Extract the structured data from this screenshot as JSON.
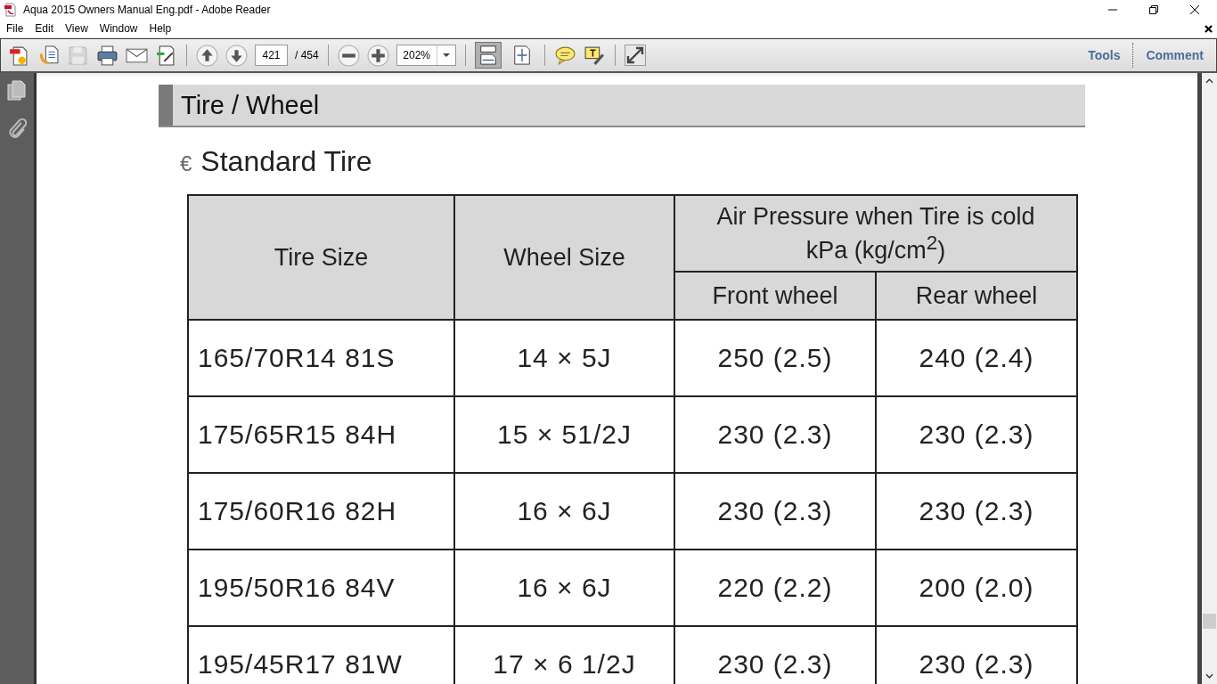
{
  "window": {
    "title": "Aqua 2015 Owners Manual Eng.pdf - Adobe Reader"
  },
  "menu": [
    "File",
    "Edit",
    "View",
    "Window",
    "Help"
  ],
  "toolbar": {
    "save_disabled": true,
    "page_number": "421",
    "page_total": "/ 454",
    "zoom": "202%",
    "view_modes": [
      {
        "selected": true
      },
      {
        "selected": false
      }
    ],
    "panels": [
      "Tools",
      "Comment"
    ]
  },
  "document": {
    "heading": "Tire / Wheel",
    "subheading_bullet": "€",
    "subheading": "Standard Tire",
    "table": {
      "columns": [
        "Tire Size",
        "Wheel Size"
      ],
      "group_header": [
        "Air Pressure when Tire is cold",
        "kPa (kg/cm$^{2}$)"
      ],
      "subcolumns": [
        "Front wheel",
        "Rear wheel"
      ],
      "rows": [
        [
          "165/70R14 81S",
          "14 × 5J",
          "250 (2.5)",
          "240 (2.4)"
        ],
        [
          "175/65R15 84H",
          "15 × 51/2J",
          "230 (2.3)",
          "230 (2.3)"
        ],
        [
          "175/60R16 82H",
          "16 × 6J",
          "230 (2.3)",
          "230 (2.3)"
        ],
        [
          "195/50R16 84V",
          "16 × 6J",
          "220 (2.2)",
          "200 (2.0)"
        ],
        [
          "195/45R17 81W",
          "17 × 6 1/2J",
          "230 (2.3)",
          "230 (2.3)"
        ]
      ]
    }
  }
}
